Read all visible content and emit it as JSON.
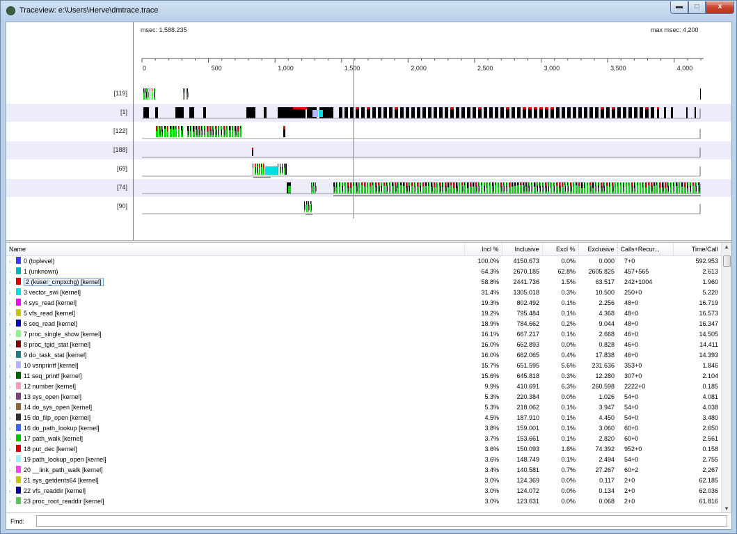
{
  "window": {
    "title": "Traceview: e:\\Users\\Herve\\dmtrace.trace",
    "min_glyph": "▬",
    "max_glyph": "□",
    "close_glyph": "x"
  },
  "timeline": {
    "msec_label": "msec: 1,588.235",
    "max_msec_label": "max msec: 4,200",
    "ticks": [
      "0",
      "500",
      "1,000",
      "1,500",
      "2,000",
      "2,500",
      "3,000",
      "3,500",
      "4,000"
    ],
    "rows": [
      "[119]",
      "[1]",
      "[122]",
      "[188]",
      "[69]",
      "[74]",
      "[90]"
    ],
    "colors": {
      "green": "#00e000",
      "red": "#e00000",
      "black": "#000000",
      "cyan": "#00e0e0",
      "band": "#ececfa"
    }
  },
  "table": {
    "headers": {
      "name": "Name",
      "incl_pct": "Incl %",
      "inclusive": "Inclusive",
      "excl_pct": "Excl %",
      "exclusive": "Exclusive",
      "calls": "Calls+Recur...",
      "time_call": "Time/Call"
    },
    "rows": [
      {
        "color": "#3c3cff",
        "name": "0 (toplevel)",
        "incl_pct": "100.0%",
        "inclusive": "4150.673",
        "excl_pct": "0.0%",
        "exclusive": "0.000",
        "calls": "7+0",
        "time_call": "592.953"
      },
      {
        "color": "#00b4b4",
        "name": "1 (unknown)",
        "incl_pct": "64.3%",
        "inclusive": "2670.185",
        "excl_pct": "62.8%",
        "exclusive": "2605.825",
        "calls": "457+565",
        "time_call": "2.613"
      },
      {
        "color": "#e00000",
        "name": "2 (kuser_cmpxchg) [kernel]",
        "incl_pct": "58.8%",
        "inclusive": "2441.736",
        "excl_pct": "1.5%",
        "exclusive": "63.517",
        "calls": "242+1004",
        "time_call": "1.960"
      },
      {
        "color": "#00e0e0",
        "name": "3 vector_swi [kernel]",
        "incl_pct": "31.4%",
        "inclusive": "1305.018",
        "excl_pct": "0.3%",
        "exclusive": "10.500",
        "calls": "250+0",
        "time_call": "5.220"
      },
      {
        "color": "#ff00ff",
        "name": "4 sys_read [kernel]",
        "incl_pct": "19.3%",
        "inclusive": "802.492",
        "excl_pct": "0.1%",
        "exclusive": "2.256",
        "calls": "48+0",
        "time_call": "16.719"
      },
      {
        "color": "#c8c800",
        "name": "5 vfs_read [kernel]",
        "incl_pct": "19.2%",
        "inclusive": "795.484",
        "excl_pct": "0.1%",
        "exclusive": "4.368",
        "calls": "48+0",
        "time_call": "16.573"
      },
      {
        "color": "#0000b4",
        "name": "6 seq_read [kernel]",
        "incl_pct": "18.9%",
        "inclusive": "784.662",
        "excl_pct": "0.2%",
        "exclusive": "9.044",
        "calls": "48+0",
        "time_call": "16.347"
      },
      {
        "color": "#90f090",
        "name": "7 proc_single_show [kernel]",
        "incl_pct": "16.1%",
        "inclusive": "667.217",
        "excl_pct": "0.1%",
        "exclusive": "2.668",
        "calls": "46+0",
        "time_call": "14.505"
      },
      {
        "color": "#800000",
        "name": "8 proc_tgid_stat [kernel]",
        "incl_pct": "16.0%",
        "inclusive": "662.893",
        "excl_pct": "0.0%",
        "exclusive": "0.828",
        "calls": "46+0",
        "time_call": "14.411"
      },
      {
        "color": "#208080",
        "name": "9 do_task_stat [kernel]",
        "incl_pct": "16.0%",
        "inclusive": "662.065",
        "excl_pct": "0.4%",
        "exclusive": "17.838",
        "calls": "46+0",
        "time_call": "14.393"
      },
      {
        "color": "#b4b4ff",
        "name": "10 vsnprintf [kernel]",
        "incl_pct": "15.7%",
        "inclusive": "651.595",
        "excl_pct": "5.6%",
        "exclusive": "231.636",
        "calls": "353+0",
        "time_call": "1.846"
      },
      {
        "color": "#006400",
        "name": "11 seq_printf [kernel]",
        "incl_pct": "15.6%",
        "inclusive": "645.818",
        "excl_pct": "0.3%",
        "exclusive": "12.280",
        "calls": "307+0",
        "time_call": "2.104"
      },
      {
        "color": "#f0a0b4",
        "name": "12 number [kernel]",
        "incl_pct": "9.9%",
        "inclusive": "410.691",
        "excl_pct": "6.3%",
        "exclusive": "260.598",
        "calls": "2222+0",
        "time_call": "0.185"
      },
      {
        "color": "#804080",
        "name": "13 sys_open [kernel]",
        "incl_pct": "5.3%",
        "inclusive": "220.384",
        "excl_pct": "0.0%",
        "exclusive": "1.026",
        "calls": "54+0",
        "time_call": "4.081"
      },
      {
        "color": "#8c6440",
        "name": "14 do_sys_open [kernel]",
        "incl_pct": "5.3%",
        "inclusive": "218.062",
        "excl_pct": "0.1%",
        "exclusive": "3.947",
        "calls": "54+0",
        "time_call": "4.038"
      },
      {
        "color": "#303030",
        "name": "15 do_filp_open [kernel]",
        "incl_pct": "4.5%",
        "inclusive": "187.910",
        "excl_pct": "0.1%",
        "exclusive": "4.450",
        "calls": "54+0",
        "time_call": "3.480"
      },
      {
        "color": "#4060ff",
        "name": "16 do_path_lookup [kernel]",
        "incl_pct": "3.8%",
        "inclusive": "159.001",
        "excl_pct": "0.1%",
        "exclusive": "3.060",
        "calls": "60+0",
        "time_call": "2.650"
      },
      {
        "color": "#00c800",
        "name": "17 path_walk [kernel]",
        "incl_pct": "3.7%",
        "inclusive": "153.661",
        "excl_pct": "0.1%",
        "exclusive": "2.820",
        "calls": "60+0",
        "time_call": "2.561"
      },
      {
        "color": "#e00000",
        "name": "18 put_dec [kernel]",
        "incl_pct": "3.6%",
        "inclusive": "150.093",
        "excl_pct": "1.8%",
        "exclusive": "74.392",
        "calls": "952+0",
        "time_call": "0.158"
      },
      {
        "color": "#a0f0f0",
        "name": "19 path_lookup_open [kernel]",
        "incl_pct": "3.6%",
        "inclusive": "148.749",
        "excl_pct": "0.1%",
        "exclusive": "2.494",
        "calls": "54+0",
        "time_call": "2.755"
      },
      {
        "color": "#ff40ff",
        "name": "20 __link_path_walk [kernel]",
        "incl_pct": "3.4%",
        "inclusive": "140.581",
        "excl_pct": "0.7%",
        "exclusive": "27.267",
        "calls": "60+2",
        "time_call": "2.267"
      },
      {
        "color": "#c8c800",
        "name": "21 sys_getdents64 [kernel]",
        "incl_pct": "3.0%",
        "inclusive": "124.369",
        "excl_pct": "0.0%",
        "exclusive": "0.117",
        "calls": "2+0",
        "time_call": "62.185"
      },
      {
        "color": "#0000a0",
        "name": "22 vfs_readdir [kernel]",
        "incl_pct": "3.0%",
        "inclusive": "124.072",
        "excl_pct": "0.0%",
        "exclusive": "0.134",
        "calls": "2+0",
        "time_call": "62.036"
      },
      {
        "color": "#60c060",
        "name": "23 proc_root_readdir [kernel]",
        "incl_pct": "3.0%",
        "inclusive": "123.631",
        "excl_pct": "0.0%",
        "exclusive": "0.068",
        "calls": "2+0",
        "time_call": "61.816"
      }
    ]
  },
  "find": {
    "label": "Find:",
    "value": ""
  }
}
